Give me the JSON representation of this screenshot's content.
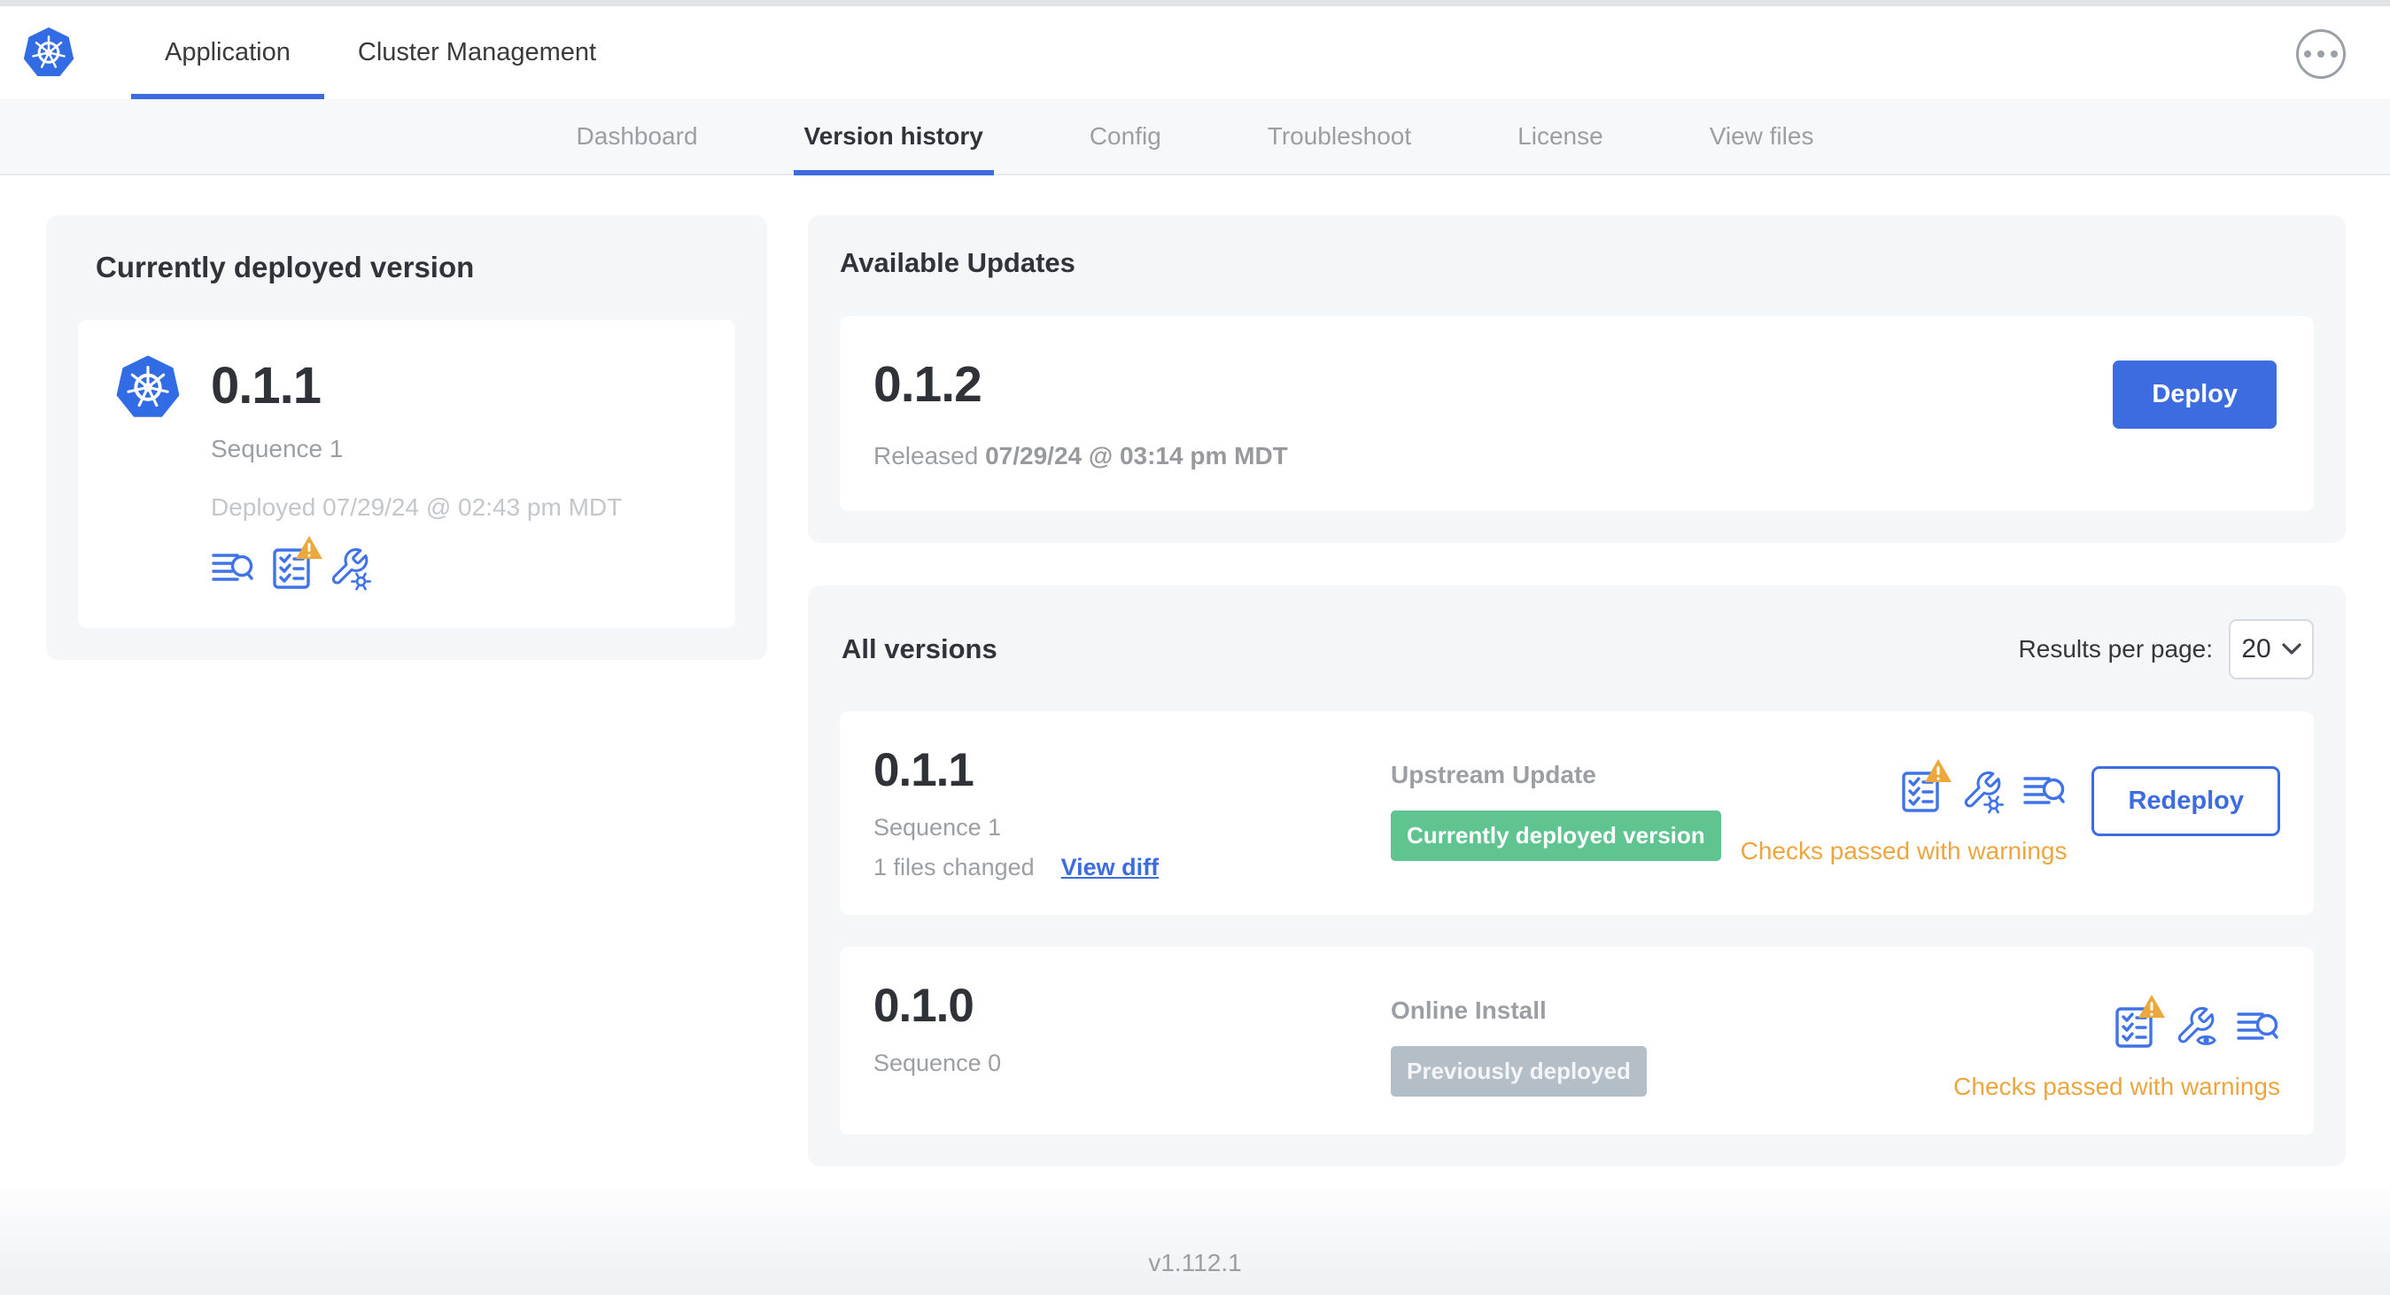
{
  "header": {
    "logo_icon": "kubernetes-logo",
    "tabs": [
      {
        "label": "Application",
        "active": true
      },
      {
        "label": "Cluster Management",
        "active": false
      }
    ],
    "more_menu_icon": "ellipsis-icon"
  },
  "subnav": {
    "tabs": [
      {
        "label": "Dashboard",
        "active": false
      },
      {
        "label": "Version history",
        "active": true
      },
      {
        "label": "Config",
        "active": false
      },
      {
        "label": "Troubleshoot",
        "active": false
      },
      {
        "label": "License",
        "active": false
      },
      {
        "label": "View files",
        "active": false
      }
    ]
  },
  "current_version": {
    "panel_title": "Currently deployed version",
    "version": "0.1.1",
    "sequence": "Sequence 1",
    "deployed": "Deployed 07/29/24 @ 02:43 pm MDT",
    "icons": [
      "logs-icon",
      "preflight-checks-warning-icon",
      "edit-config-icon"
    ]
  },
  "available_updates": {
    "panel_title": "Available Updates",
    "version": "0.1.2",
    "released_prefix": "Released",
    "released_date": "07/29/24 @ 03:14 pm MDT",
    "deploy_label": "Deploy"
  },
  "all_versions": {
    "panel_title": "All versions",
    "results_per_page_label": "Results per page:",
    "results_per_page_value": "20",
    "rows": [
      {
        "version": "0.1.1",
        "sequence": "Sequence 1",
        "files_changed": "1 files changed",
        "view_diff_label": "View diff",
        "source": "Upstream Update",
        "badge_label": "Currently deployed version",
        "badge_color": "#5fc48f",
        "icons": [
          "preflight-checks-warning-icon",
          "edit-config-icon",
          "logs-icon"
        ],
        "status": "Checks passed with warnings",
        "action_label": "Redeploy"
      },
      {
        "version": "0.1.0",
        "sequence": "Sequence 0",
        "source": "Online Install",
        "badge_label": "Previously deployed",
        "badge_color": "#b3bec7",
        "icons": [
          "preflight-checks-warning-icon",
          "view-config-icon",
          "logs-icon"
        ],
        "status": "Checks passed with warnings"
      }
    ]
  },
  "footer": {
    "app_version": "v1.112.1"
  },
  "colors": {
    "accent_blue": "#3d6ce0",
    "kubernetes_blue": "#326ce5",
    "badge_green": "#5fc48f",
    "badge_gray": "#b3bec7",
    "warning_orange": "#eca63f",
    "panel_background": "#f5f6f8",
    "text_dark": "#30343a",
    "text_gray": "#9b9fa4",
    "text_muted": "#c3c7cc"
  }
}
